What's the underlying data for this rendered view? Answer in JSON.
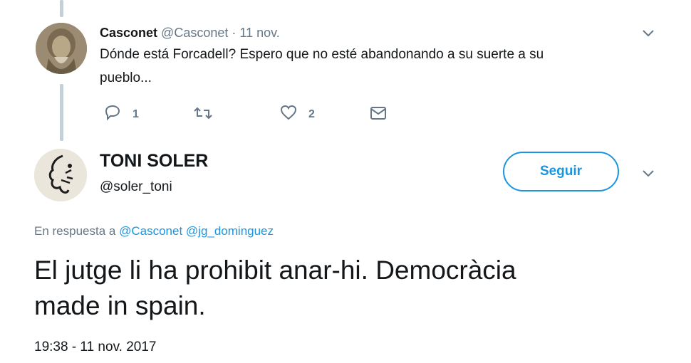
{
  "parent_tweet": {
    "name": "Casconet",
    "handle": "@Casconet",
    "separator": "·",
    "date": "11 nov.",
    "text_line1": "Dónde está Forcadell?  Espero que no esté abandonando a su suerte a su",
    "text_line2": "pueblo...",
    "reply_count": "1",
    "like_count": "2"
  },
  "main_tweet": {
    "name": "TONI SOLER",
    "handle": "@soler_toni",
    "follow_label": "Seguir",
    "reply_prefix": "En respuesta a",
    "reply_to": [
      "@Casconet",
      "@jg_dominguez"
    ],
    "text_line1": "El jutge li ha prohibit anar-hi. Democràcia",
    "text_line2": "made in spain.",
    "timestamp": "19:38 - 11 nov. 2017"
  },
  "icons": {
    "caret": "chevron-down-icon",
    "reply": "reply-icon",
    "retweet": "retweet-icon",
    "like": "heart-icon",
    "dm": "envelope-icon"
  },
  "colors": {
    "accent": "#1b95e0",
    "muted": "#657786",
    "text": "#14171a",
    "thread_line": "#c4cfd6"
  }
}
